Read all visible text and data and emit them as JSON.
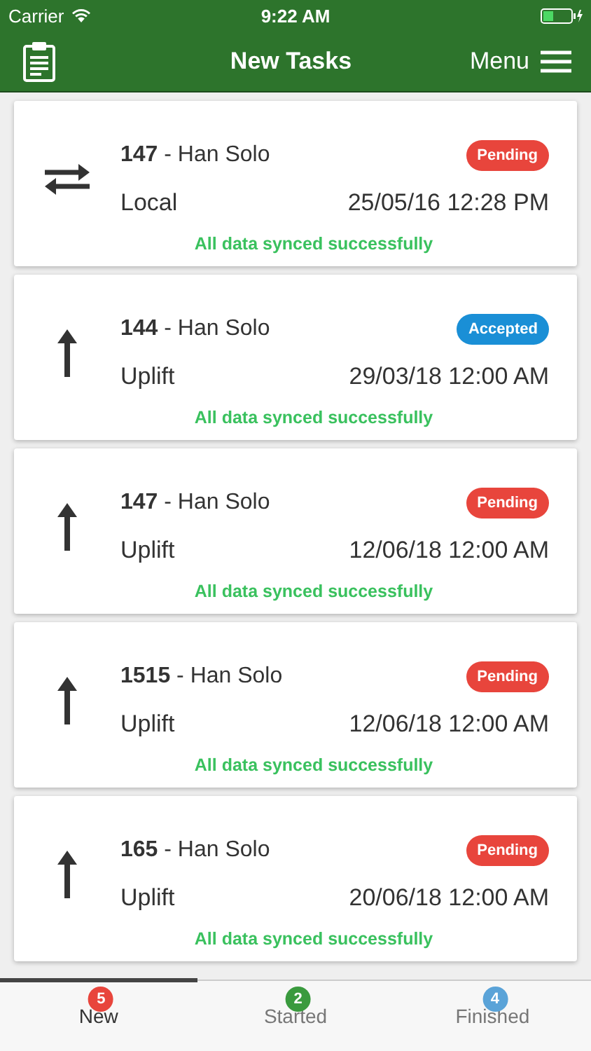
{
  "status_bar": {
    "carrier": "Carrier",
    "time": "9:22 AM"
  },
  "header": {
    "title": "New Tasks",
    "menu": "Menu"
  },
  "tasks": [
    {
      "kind": "swap",
      "number": "147",
      "name": " - Han Solo",
      "type": "Local",
      "date": "25/05/16 12:28 PM",
      "status": "Pending",
      "color": "#e8453c",
      "sync": "All data synced successfully"
    },
    {
      "kind": "upload",
      "number": "144",
      "name": " - Han Solo",
      "type": "Uplift",
      "date": "29/03/18 12:00 AM",
      "status": "Accepted",
      "color": "#1a8fd6",
      "sync": "All data synced successfully"
    },
    {
      "kind": "upload",
      "number": "147",
      "name": " - Han Solo",
      "type": "Uplift",
      "date": "12/06/18 12:00 AM",
      "status": "Pending",
      "color": "#e8453c",
      "sync": "All data synced successfully"
    },
    {
      "kind": "upload",
      "number": "1515",
      "name": " - Han Solo",
      "type": "Uplift",
      "date": "12/06/18 12:00 AM",
      "status": "Pending",
      "color": "#e8453c",
      "sync": "All data synced successfully"
    },
    {
      "kind": "upload",
      "number": "165",
      "name": " - Han Solo",
      "type": "Uplift",
      "date": "20/06/18 12:00 AM",
      "status": "Pending",
      "color": "#e8453c",
      "sync": "All data synced successfully"
    }
  ],
  "tabs": [
    {
      "label": "New",
      "count": "5",
      "color": "#e8453c",
      "selected": true
    },
    {
      "label": "Started",
      "count": "2",
      "color": "#3a9a3e",
      "selected": false
    },
    {
      "label": "Finished",
      "count": "4",
      "color": "#5aa3d8",
      "selected": false
    }
  ]
}
